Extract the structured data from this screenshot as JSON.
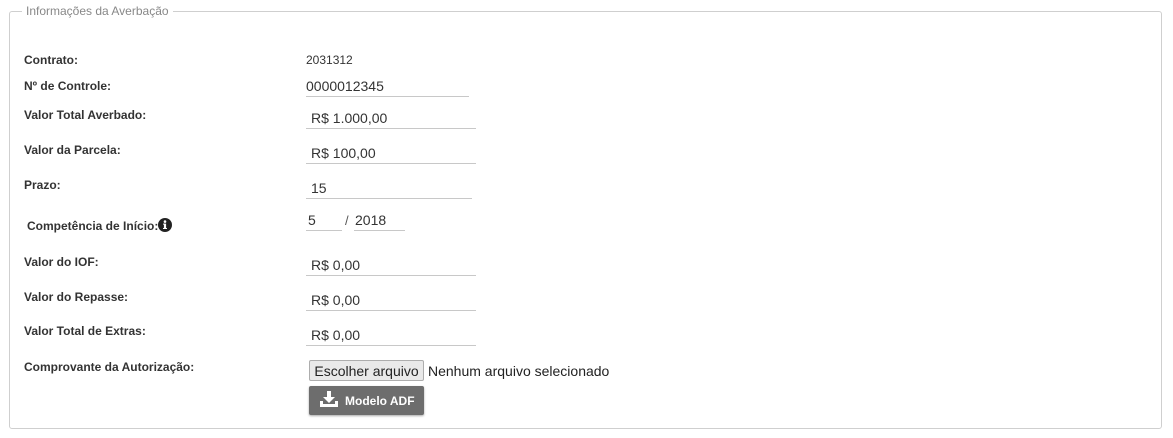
{
  "section": {
    "legend": "Informações da Averbação"
  },
  "form": {
    "contrato": {
      "label": "Contrato:",
      "value": "2031312"
    },
    "controle": {
      "label": "Nº de Controle:",
      "value": "0000012345"
    },
    "valor_total_averbado": {
      "label": "Valor Total Averbado:",
      "value": "R$ 1.000,00"
    },
    "valor_parcela": {
      "label": "Valor da Parcela:",
      "value": "R$ 100,00"
    },
    "prazo": {
      "label": "Prazo:",
      "value": "15"
    },
    "competencia": {
      "label": "Competência de Início:",
      "month": "5",
      "separator": "/",
      "year": "2018"
    },
    "valor_iof": {
      "label": "Valor do IOF:",
      "value": "R$ 0,00"
    },
    "valor_repasse": {
      "label": "Valor do Repasse:",
      "value": "R$ 0,00"
    },
    "valor_extras": {
      "label": "Valor Total de Extras:",
      "value": "R$ 0,00"
    },
    "comprovante": {
      "label": "Comprovante da Autorização:",
      "file_button": "Escolher arquivo",
      "file_status": "Nenhum arquivo selecionado"
    }
  },
  "actions": {
    "modelo_adf": "Modelo ADF"
  },
  "icons": {
    "info": "info-icon",
    "download": "download-icon"
  }
}
